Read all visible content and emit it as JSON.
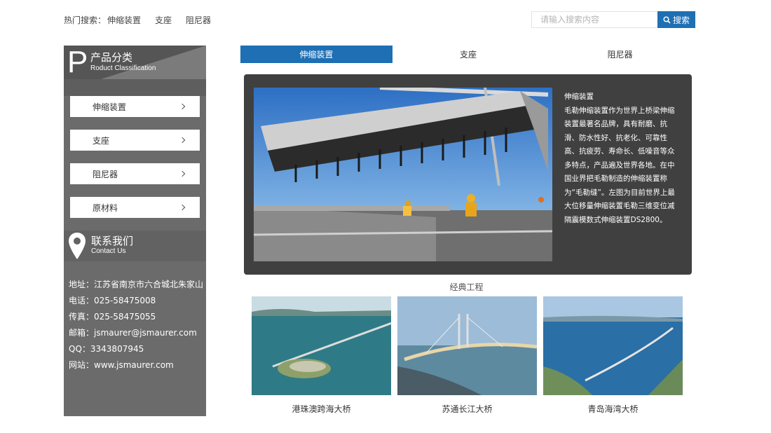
{
  "top": {
    "hot_label": "热门搜索：",
    "hot_links": [
      "伸缩装置",
      "支座",
      "阻尼器"
    ],
    "search_placeholder": "请输入搜索内容",
    "search_button": "搜索"
  },
  "sidebar": {
    "letter": "P",
    "title": "产品分类",
    "subtitle": "Roduct Classification",
    "items": [
      "伸缩装置",
      "支座",
      "阻尼器",
      "原材料"
    ],
    "contact_title": "联系我们",
    "contact_subtitle": "Contact Us",
    "contact": [
      "地址：江苏省南京市六合城北朱家山",
      "电话：025-58475008",
      "传真：025-58475055",
      "邮箱：jsmaurer@jsmaurer.com",
      "QQ：3343807945",
      "网站：www.jsmaurer.com"
    ]
  },
  "tabs": [
    "伸缩装置",
    "支座",
    "阻尼器"
  ],
  "feature": {
    "text": "伸缩装置\n毛勒伸缩装置作为世界上桥梁伸缩装置最著名品牌，具有耐磨、抗滑、防水性好、抗老化、可靠性高、抗疲劳、寿命长、低噪音等众多特点，产品遍及世界各地。在中国业界把毛勒制造的伸缩装置称为“毛勒缝”。左图为目前世界上最大位移量伸缩装置毛勒三维变位减隔震模数式伸缩装置DS2800。"
  },
  "projects": {
    "title": "经典工程",
    "items": [
      "港珠澳跨海大桥",
      "苏通长江大桥",
      "青岛海湾大桥"
    ]
  },
  "colors": {
    "accent": "#1e6fb3",
    "sidebar": "#6b6b6b",
    "feature_bg": "#404040"
  }
}
